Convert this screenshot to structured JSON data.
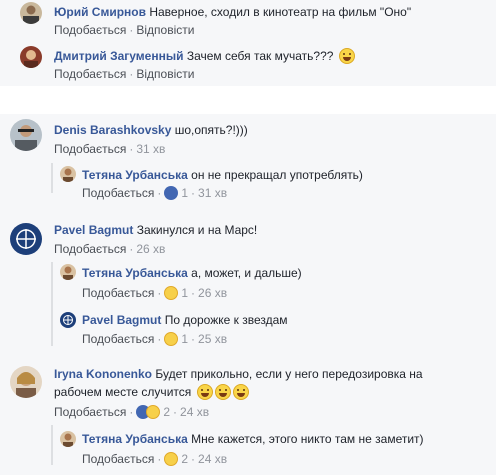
{
  "labels": {
    "like": "Подобається",
    "reply": "Відповісти",
    "separator": "·"
  },
  "top_comments": [
    {
      "author": "Юрий Смирнов",
      "text": "Наверное, сходил в кинотеатр на фильм \"Оно\""
    },
    {
      "author": "Дмитрий Загуменный",
      "text": "Зачем себя так мучать???"
    }
  ],
  "thread": [
    {
      "author": "Denis Barashkovsky",
      "text": "шо,опять?!)))",
      "time": "31 хв"
    },
    {
      "author": "Тетяна Урбанська",
      "text": "он не прекращал употреблять)",
      "reactions": "1",
      "time": "31 хв"
    },
    {
      "author": "Pavel Bagmut",
      "text": "Закинулся и на Марс!",
      "time": "26 хв"
    },
    {
      "author": "Тетяна Урбанська",
      "text": "а, может, и дальше)",
      "reactions": "1",
      "time": "26 хв"
    },
    {
      "author": "Pavel Bagmut",
      "text": "По дорожке к звездам",
      "reactions": "1",
      "time": "25 хв"
    },
    {
      "author": "Iryna Kononenko",
      "text_line1": "Будет прикольно, если у него передозировка на",
      "text_line2": "рабочем месте случится",
      "reactions": "2",
      "time": "24 хв"
    },
    {
      "author": "Тетяна Урбанська",
      "text": "Мне кажется, этого никто там не заметит)",
      "reactions": "2",
      "time": "24 хв"
    }
  ],
  "colors": {
    "author": "#385898",
    "action": "#4b4f56",
    "meta": "#90949c",
    "like_reaction": "#4267b2",
    "haha_reaction": "#f7d04a",
    "panel_background": "#f6f7f9"
  }
}
